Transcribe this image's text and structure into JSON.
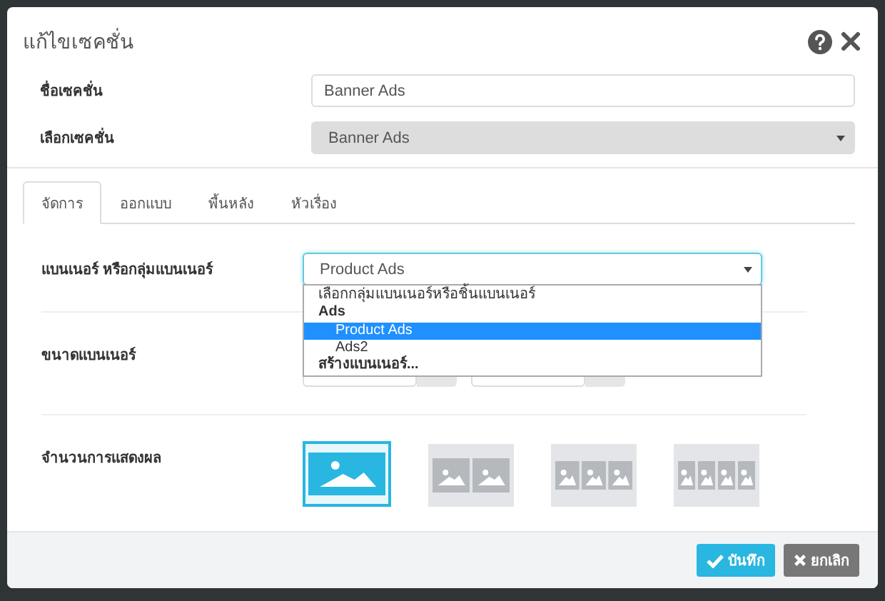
{
  "dialog": {
    "title": "แก้ไขเซคชั่น"
  },
  "fields": [
    {
      "kind": "text",
      "label": "ชื่อเซคชั่น",
      "value": "Banner Ads"
    },
    {
      "kind": "select",
      "label": "เลือกเซคชั่น",
      "value": "Banner Ads"
    }
  ],
  "tabs": [
    {
      "label": "จัดการ",
      "selected": true
    },
    {
      "label": "ออกแบบ",
      "selected": false
    },
    {
      "label": "พื้นหลัง",
      "selected": false
    },
    {
      "label": "หัวเรื่อง",
      "selected": false
    }
  ],
  "banner": {
    "label": "แบนเนอร์ หรือกลุ่มแบนเนอร์",
    "value": "Product Ads",
    "dropdown": [
      {
        "kind": "option",
        "label": "เลือกกลุ่มแบนเนอร์หรือชิ้นแบนเนอร์",
        "selected": false
      },
      {
        "kind": "group",
        "label": "Ads",
        "children": [
          {
            "label": "Product Ads",
            "selected": true
          },
          {
            "label": "Ads2",
            "selected": false
          }
        ]
      },
      {
        "kind": "action",
        "label": "สร้างแบนเนอร์..."
      }
    ]
  },
  "size": {
    "label": "ขนาดแบนเนอร์"
  },
  "display": {
    "label": "จำนวนการแสดงผล",
    "layouts": [
      {
        "selected": true
      },
      {
        "selected": false
      },
      {
        "selected": false
      },
      {
        "selected": false
      }
    ]
  },
  "buttons": [
    {
      "kind": "save",
      "label": "บันทึก"
    },
    {
      "kind": "cancel",
      "label": "ยกเลิก"
    }
  ]
}
